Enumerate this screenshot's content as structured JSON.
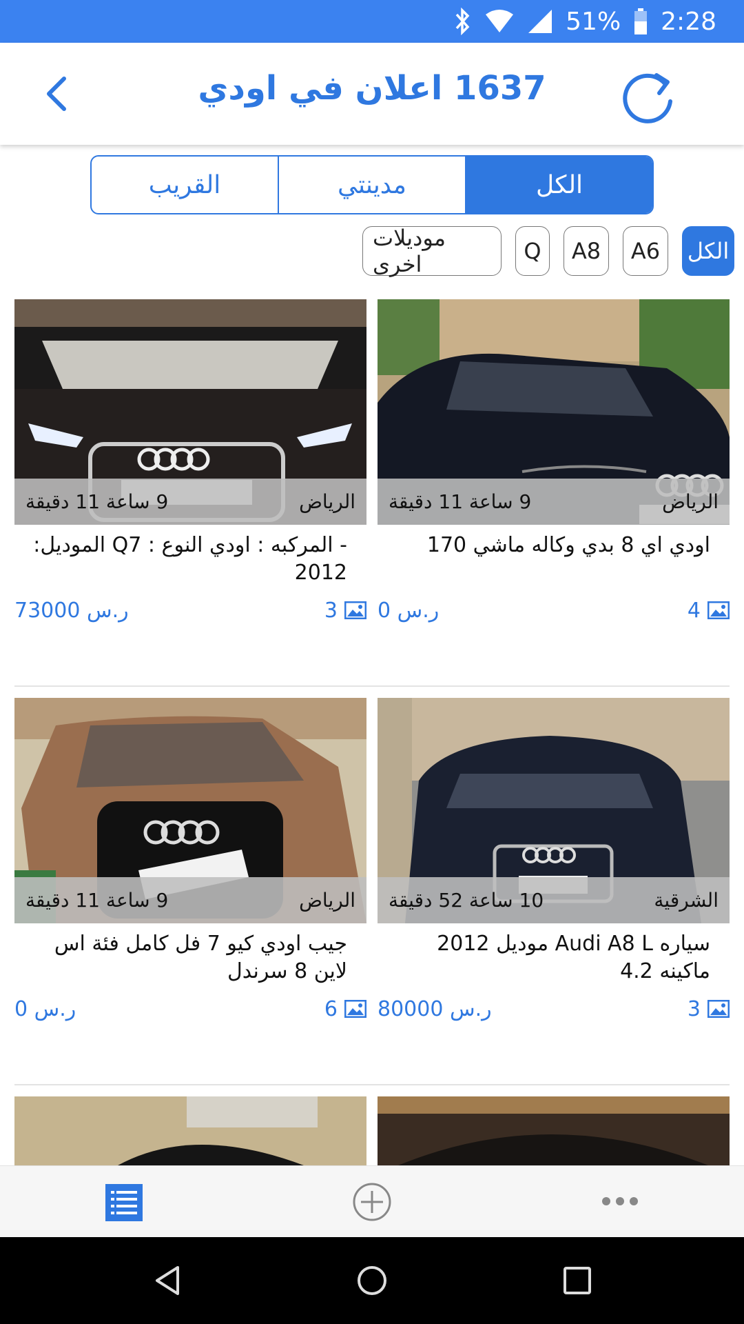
{
  "status": {
    "battery": "51%",
    "time": "2:28"
  },
  "header": {
    "title": "1637 اعلان في اودي"
  },
  "segments": [
    {
      "label": "القريب",
      "active": false
    },
    {
      "label": "مدينتي",
      "active": false
    },
    {
      "label": "الكل",
      "active": true
    }
  ],
  "chips": [
    {
      "label": "الكل",
      "active": true
    },
    {
      "label": "A6",
      "active": false
    },
    {
      "label": "A8",
      "active": false
    },
    {
      "label": "Q",
      "active": false
    },
    {
      "label": "موديلات اخرى",
      "active": false
    }
  ],
  "listings": [
    {
      "city": "الرياض",
      "time": "9 ساعة 11 دقيقة",
      "title": "اودي اي 8  بدي وكاله  ماشي 170",
      "price": "0 ر.س",
      "photos": "4"
    },
    {
      "city": "الرياض",
      "time": "9 ساعة 11 دقيقة",
      "title": "-   المركبه : اودي  النوع : Q7  الموديل: 2012",
      "price": "73000 ر.س",
      "photos": "3"
    },
    {
      "city": "الشرقية",
      "time": "10 ساعة 52 دقيقة",
      "title": "سياره Audi A8 L  موديل 2012 ماكينه 4.2",
      "price": "80000 ر.س",
      "photos": "3"
    },
    {
      "city": "الرياض",
      "time": "9 ساعة 11 دقيقة",
      "title": "جيب اودي كيو 7 فل كامل فئة اس لاين  8 سرندل",
      "price": "0 ر.س",
      "photos": "6"
    }
  ],
  "colors": {
    "accent": "#2f78e0",
    "statusbar": "#3b82f0"
  }
}
